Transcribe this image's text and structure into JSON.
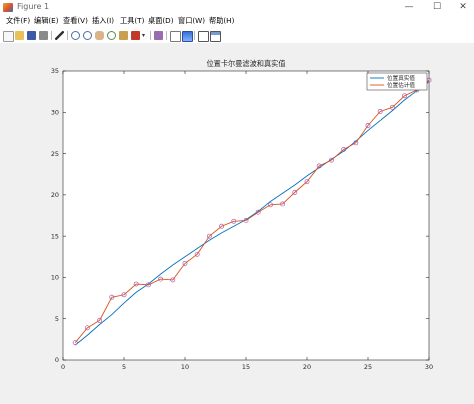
{
  "window": {
    "title": "Figure 1",
    "minimize": "—",
    "maximize": "☐",
    "close": "✕"
  },
  "menu": [
    "文件(F)",
    "编辑(E)",
    "查看(V)",
    "插入(I)",
    "工具(T)",
    "桌面(D)",
    "窗口(W)",
    "帮助(H)"
  ],
  "toolbar": {
    "icons": [
      "new-figure-icon",
      "open-file-icon",
      "save-icon",
      "print-icon",
      "pointer-icon",
      "zoom-in-icon",
      "zoom-out-icon",
      "pan-icon",
      "rotate-icon",
      "data-cursor-icon",
      "brush-icon",
      "link-icon",
      "colorbar-icon",
      "legend-icon",
      "hide-plot-tools-icon",
      "show-plot-tools-icon"
    ],
    "accent": "#3c6fb0"
  },
  "chart_data": {
    "type": "line",
    "title": "位置卡尔曼滤波和真实值",
    "xlabel": "",
    "ylabel": "",
    "xlim": [
      0,
      30
    ],
    "ylim": [
      0,
      35
    ],
    "xticks": [
      0,
      5,
      10,
      15,
      20,
      25,
      30
    ],
    "yticks": [
      0,
      5,
      10,
      15,
      20,
      25,
      30,
      35
    ],
    "grid": false,
    "legend_position": "top-right",
    "x": [
      1,
      2,
      3,
      4,
      5,
      6,
      7,
      8,
      9,
      10,
      11,
      12,
      13,
      14,
      15,
      16,
      17,
      18,
      19,
      20,
      21,
      22,
      23,
      24,
      25,
      26,
      27,
      28,
      29,
      30
    ],
    "series": [
      {
        "name": "位置真实值",
        "color": "#0072bd",
        "marker": "none",
        "values": [
          1.8,
          3.0,
          4.3,
          5.5,
          6.9,
          8.2,
          9.2,
          10.4,
          11.5,
          12.5,
          13.5,
          14.5,
          15.4,
          16.2,
          17.0,
          18.0,
          19.2,
          20.2,
          21.2,
          22.3,
          23.3,
          24.3,
          25.3,
          26.5,
          27.8,
          29.0,
          30.2,
          31.5,
          32.6,
          33.7
        ]
      },
      {
        "name": "位置估计值",
        "color": "#d95319",
        "marker": "o",
        "marker_color": "#b05aa8",
        "values": [
          2.1,
          3.9,
          4.8,
          7.6,
          7.9,
          9.2,
          9.1,
          9.8,
          9.7,
          11.7,
          12.8,
          15.0,
          16.2,
          16.8,
          16.9,
          17.9,
          18.8,
          18.9,
          20.3,
          21.6,
          23.5,
          24.2,
          25.5,
          26.3,
          28.4,
          30.1,
          30.6,
          32.0,
          32.7,
          33.9
        ]
      }
    ]
  }
}
